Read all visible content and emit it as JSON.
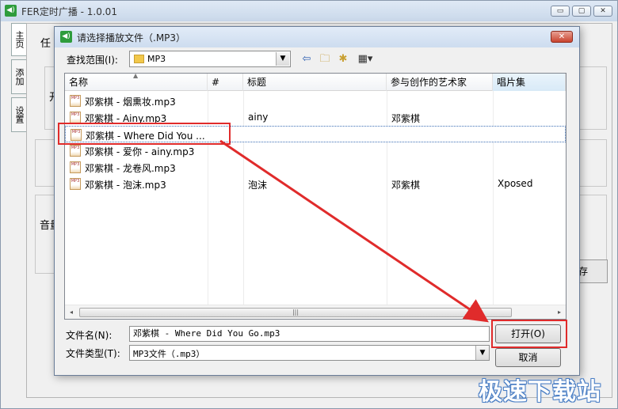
{
  "main_window": {
    "title": "FER定时广播 - 1.0.01",
    "caption_min": "▭",
    "caption_max": "▢",
    "caption_close": "✕",
    "side_tabs": [
      "主页",
      "添加",
      "设置"
    ],
    "partial_labels": {
      "task": "任",
      "left1": "开",
      "sound": "音量",
      "save": "存"
    }
  },
  "dialog": {
    "title": "请选择播放文件（.MP3）",
    "close_label": "✕",
    "lookin_label": "查找范围(I):",
    "lookin_value": "MP3",
    "toolbar_icons": [
      "back-icon",
      "up-folder-icon",
      "new-folder-icon",
      "view-menu-icon"
    ],
    "columns": [
      "名称",
      "#",
      "标题",
      "参与创作的艺术家",
      "唱片集"
    ],
    "files": [
      {
        "name": "邓紫棋 - 烟熏妆.mp3",
        "num": "",
        "title": "",
        "artist": "",
        "album": ""
      },
      {
        "name": "邓紫棋 - Ainy.mp3",
        "num": "",
        "title": "ainy",
        "artist": "邓紫棋",
        "album": ""
      },
      {
        "name": "邓紫棋 - Where Did You ...",
        "num": "",
        "title": "",
        "artist": "",
        "album": "",
        "selected": true
      },
      {
        "name": "邓紫棋 - 爱你 - ainy.mp3",
        "num": "",
        "title": "",
        "artist": "",
        "album": ""
      },
      {
        "name": "邓紫棋 - 龙卷风.mp3",
        "num": "",
        "title": "",
        "artist": "",
        "album": ""
      },
      {
        "name": "邓紫棋 - 泡沫.mp3",
        "num": "",
        "title": "泡沫",
        "artist": "邓紫棋",
        "album": "Xposed"
      }
    ],
    "file_icon_text": "MP3",
    "scroll_grip": "|||",
    "scroll_left": "◂",
    "scroll_right": "▸",
    "filename_label": "文件名(N):",
    "filename_value": "邓紫棋 - Where Did You Go.mp3",
    "filetype_label": "文件类型(T):",
    "filetype_value": "MP3文件（.mp3）",
    "open_button": "打开(O)",
    "cancel_button": "取消"
  },
  "watermark": "极速下载站",
  "colors": {
    "highlight": "#e02b2b",
    "titlebar": "#cddcef",
    "dialog_bg": "#f0f0f0"
  }
}
